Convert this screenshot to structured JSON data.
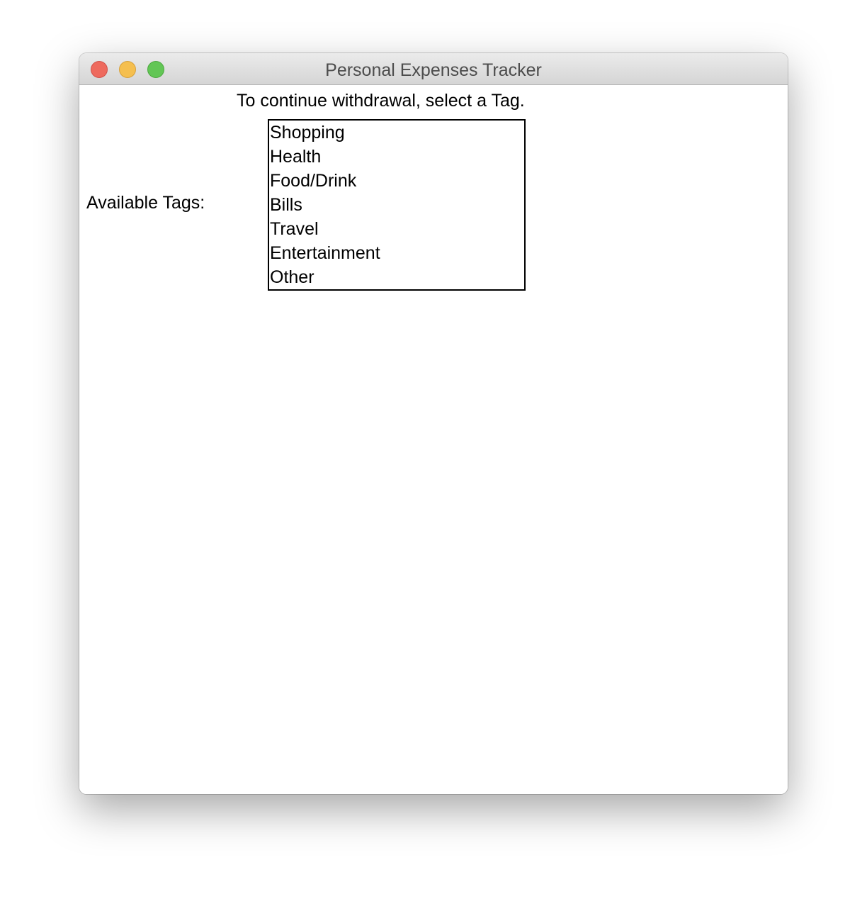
{
  "window": {
    "title": "Personal Expenses Tracker"
  },
  "instruction": "To continue withdrawal, select a Tag.",
  "tags_label": "Available Tags:",
  "tags": [
    "Shopping",
    "Health",
    "Food/Drink",
    "Bills",
    "Travel",
    "Entertainment",
    "Other"
  ],
  "colors": {
    "close": "#ee6a5e",
    "minimize": "#f5bf4f",
    "zoom": "#62c655"
  }
}
